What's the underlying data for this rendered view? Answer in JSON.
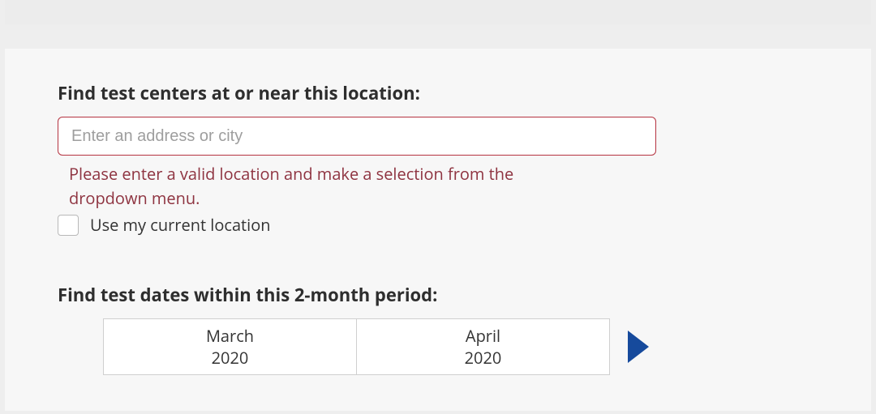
{
  "location_section": {
    "heading": "Find test centers at or near this location:",
    "input_placeholder": "Enter an address or city",
    "input_value": "",
    "error_message": "Please enter a valid location and make a selection from the dropdown menu.",
    "use_current_location_label": "Use my current location",
    "use_current_location_checked": false
  },
  "date_section": {
    "heading": "Find test dates within this 2-month period:",
    "months": [
      {
        "name": "March",
        "year": "2020"
      },
      {
        "name": "April",
        "year": "2020"
      }
    ],
    "next_arrow_name": "next-months-arrow"
  }
}
